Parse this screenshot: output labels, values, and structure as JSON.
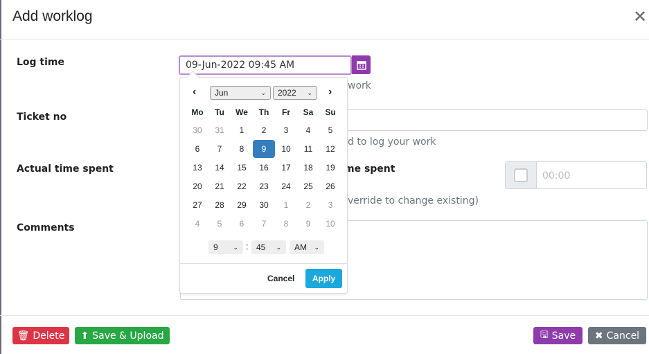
{
  "dialog": {
    "title": "Add worklog"
  },
  "fields": {
    "log_time": {
      "label": "Log time",
      "value": "09-Jun-2022 09:45 AM",
      "help_fragment": "work"
    },
    "ticket_no": {
      "label": "Ticket no",
      "help_fragment": "d to log your work"
    },
    "actual_time": {
      "label": "Actual time spent",
      "right_label_fragment": "me spent",
      "placeholder": "00:00",
      "help_fragment": "verride to change existing)"
    },
    "comments": {
      "label": "Comments"
    }
  },
  "datepicker": {
    "month": "Jun",
    "year": "2022",
    "weekdays": [
      "Mo",
      "Tu",
      "We",
      "Th",
      "Fr",
      "Sa",
      "Su"
    ],
    "weeks": [
      [
        "30",
        "31",
        "1",
        "2",
        "3",
        "4",
        "5"
      ],
      [
        "6",
        "7",
        "8",
        "9",
        "10",
        "11",
        "12"
      ],
      [
        "13",
        "14",
        "15",
        "16",
        "17",
        "18",
        "19"
      ],
      [
        "20",
        "21",
        "22",
        "23",
        "24",
        "25",
        "26"
      ],
      [
        "27",
        "28",
        "29",
        "30",
        "1",
        "2",
        "3"
      ],
      [
        "4",
        "5",
        "6",
        "7",
        "8",
        "9",
        "10"
      ]
    ],
    "selected_day": "9",
    "hour": "9",
    "minute": "45",
    "ampm": "AM",
    "cancel_label": "Cancel",
    "apply_label": "Apply"
  },
  "footer": {
    "delete_label": "Delete",
    "save_upload_label": "Save & Upload",
    "save_label": "Save",
    "cancel_label": "Cancel"
  },
  "colors": {
    "primary": "#8e3cac",
    "danger": "#dc3545",
    "success": "#28a745",
    "secondary": "#6c757d",
    "apply": "#1ba8dc",
    "selected": "#357ebd"
  }
}
